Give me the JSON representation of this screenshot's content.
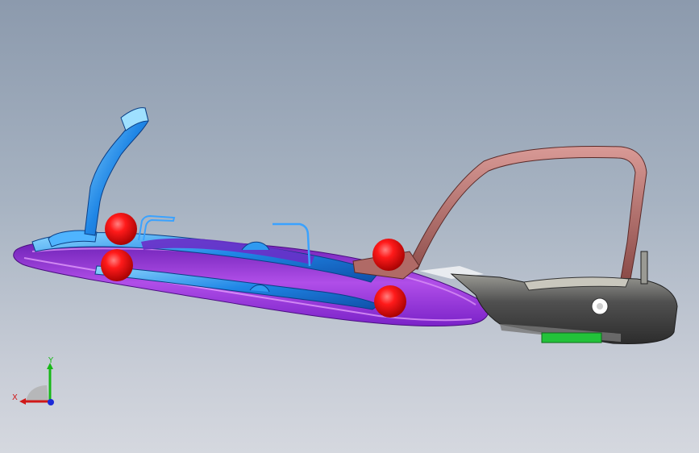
{
  "viewport": {
    "background_top": "#8c9aad",
    "background_bottom": "#d5d8df"
  },
  "model": {
    "colors": {
      "base_plate": "#8d2fd6",
      "base_plate_light": "#d36bf0",
      "frame_blue": "#1f86e6",
      "frame_blue_light": "#7fd0ff",
      "handle_brown": "#b46d6b",
      "handle_brown_dark": "#6e3a3a",
      "clamp_gray": "#4a4a4a",
      "clamp_light": "#b8b8b0",
      "marker_red": "#e01010",
      "pad_green": "#22c23a"
    },
    "markers": 4
  },
  "triad": {
    "x_label": "X",
    "y_label": "Y",
    "x_color": "#d01818",
    "y_color": "#18b818",
    "z_color": "#1b2ad8"
  }
}
